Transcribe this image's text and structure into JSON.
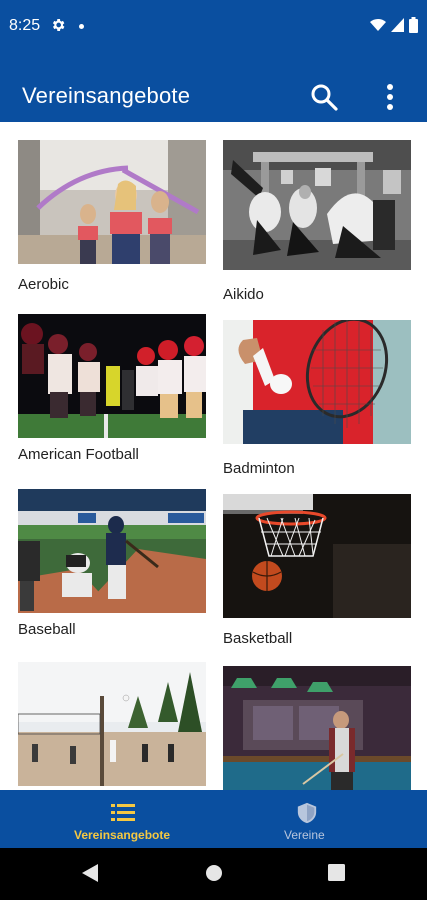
{
  "status_bar": {
    "time": "8:25",
    "icons": [
      "gear-icon",
      "notification-dot-icon",
      "wifi-icon",
      "cell-signal-icon",
      "battery-icon"
    ]
  },
  "app_bar": {
    "title": "Vereinsangebote",
    "actions": [
      "search-icon",
      "more-vert-icon"
    ],
    "color": "#0a4fa0"
  },
  "offers": [
    {
      "label": "Aerobic",
      "image": "aerobic-photo"
    },
    {
      "label": "Aikido",
      "image": "aikido-photo"
    },
    {
      "label": "American Football",
      "image": "american-football-photo"
    },
    {
      "label": "Badminton",
      "image": "badminton-photo"
    },
    {
      "label": "Baseball",
      "image": "baseball-photo"
    },
    {
      "label": "Basketball",
      "image": "basketball-photo"
    },
    {
      "label": "",
      "image": "beach-volleyball-photo"
    },
    {
      "label": "",
      "image": "billiards-photo"
    }
  ],
  "bottom_nav": {
    "items": [
      {
        "label": "Vereinsangebote",
        "icon": "list-icon",
        "active": true
      },
      {
        "label": "Vereine",
        "icon": "shield-icon",
        "active": false
      }
    ],
    "active_color": "#f5c842"
  },
  "system_nav": [
    "back-icon",
    "home-icon",
    "recents-icon"
  ]
}
